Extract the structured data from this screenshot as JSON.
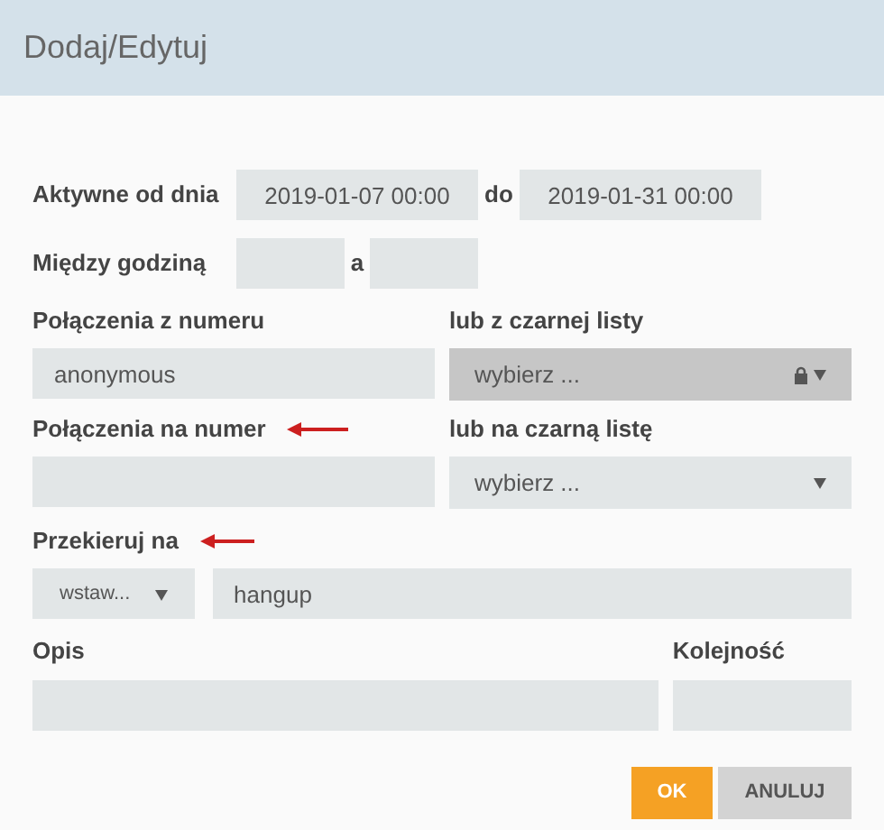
{
  "window": {
    "title": "Dodaj/Edytuj"
  },
  "active_from": {
    "label": "Aktywne od dnia",
    "from": "2019-01-07 00:00",
    "separator": "do",
    "to": "2019-01-31 00:00"
  },
  "between_hours": {
    "label": "Między godziną",
    "separator": "a"
  },
  "from_number": {
    "label": "Połączenia z numeru",
    "value": "anonymous",
    "arrow": false
  },
  "from_blacklist": {
    "label": "lub z czarnej listy",
    "placeholder": "wybierz ...",
    "locked": true
  },
  "to_number": {
    "label": "Połączenia na numer",
    "arrow": true
  },
  "to_blacklist": {
    "label": "lub na czarną listę",
    "placeholder": "wybierz ...",
    "locked": false
  },
  "redirect": {
    "label": "Przekieruj na",
    "arrow": true,
    "insert_select": "wstaw...",
    "value": "hangup"
  },
  "description": {
    "label": "Opis"
  },
  "order": {
    "label": "Kolejność"
  },
  "buttons": [
    {
      "label": "OK",
      "kind": "primary"
    },
    {
      "label": "ANULUJ",
      "kind": "secondary"
    }
  ]
}
